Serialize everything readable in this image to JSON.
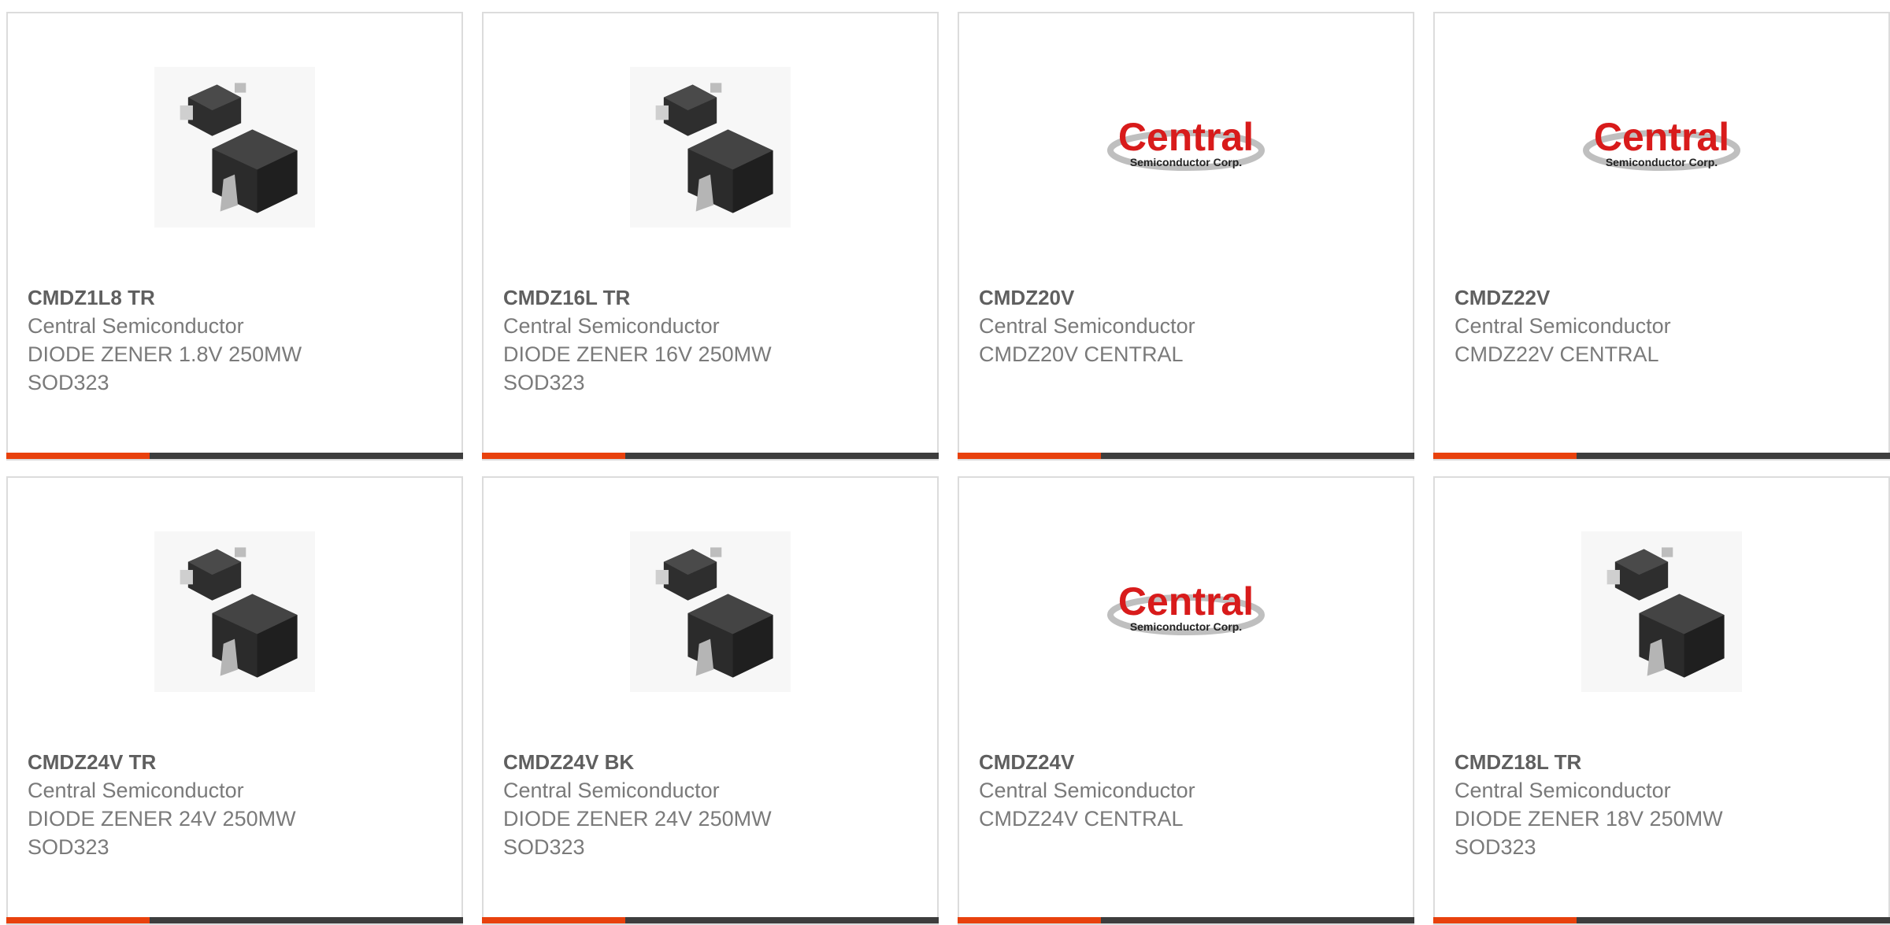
{
  "colors": {
    "accent": "#e8410d",
    "bar": "#3d3d3d",
    "border": "#dcdcdc",
    "logo_red": "#d81b1b"
  },
  "products": [
    {
      "part_number": "CMDZ1L8 TR",
      "manufacturer": "Central Semiconductor",
      "description": "DIODE ZENER 1.8V 250MW\nSOD323",
      "image": "sod323-package-icon"
    },
    {
      "part_number": "CMDZ16L TR",
      "manufacturer": "Central Semiconductor",
      "description": "DIODE ZENER 16V 250MW\nSOD323",
      "image": "sod323-package-icon"
    },
    {
      "part_number": "CMDZ20V",
      "manufacturer": "Central Semiconductor",
      "description": "CMDZ20V CENTRAL",
      "image": "central-logo",
      "logo_text": "Central",
      "logo_subtext": "Semiconductor Corp."
    },
    {
      "part_number": "CMDZ22V",
      "manufacturer": "Central Semiconductor",
      "description": "CMDZ22V CENTRAL",
      "image": "central-logo",
      "logo_text": "Central",
      "logo_subtext": "Semiconductor Corp."
    },
    {
      "part_number": "CMDZ24V TR",
      "manufacturer": "Central Semiconductor",
      "description": "DIODE ZENER 24V 250MW\nSOD323",
      "image": "sod323-package-icon"
    },
    {
      "part_number": "CMDZ24V BK",
      "manufacturer": "Central Semiconductor",
      "description": "DIODE ZENER 24V 250MW\nSOD323",
      "image": "sod323-package-icon"
    },
    {
      "part_number": "CMDZ24V",
      "manufacturer": "Central Semiconductor",
      "description": "CMDZ24V CENTRAL",
      "image": "central-logo",
      "logo_text": "Central",
      "logo_subtext": "Semiconductor Corp."
    },
    {
      "part_number": "CMDZ18L TR",
      "manufacturer": "Central Semiconductor",
      "description": "DIODE ZENER 18V 250MW\nSOD323",
      "image": "sod323-package-icon"
    }
  ]
}
